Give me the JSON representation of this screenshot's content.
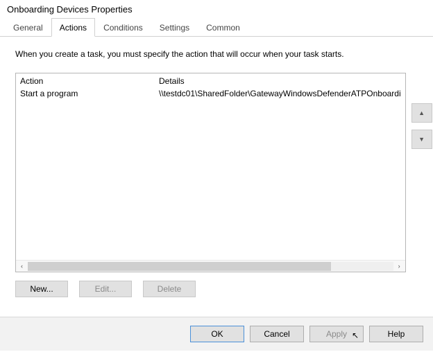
{
  "window": {
    "title": "Onboarding Devices Properties"
  },
  "tabs": [
    {
      "label": "General",
      "active": false
    },
    {
      "label": "Actions",
      "active": true
    },
    {
      "label": "Conditions",
      "active": false
    },
    {
      "label": "Settings",
      "active": false
    },
    {
      "label": "Common",
      "active": false
    }
  ],
  "instruction": "When you create a task, you must specify the action that will occur when your task starts.",
  "columns": {
    "action": "Action",
    "details": "Details"
  },
  "rows": [
    {
      "action": "Start a program",
      "details": "\\\\testdc01\\SharedFolder\\GatewayWindowsDefenderATPOnboardi"
    }
  ],
  "sideButtons": {
    "up": "▲",
    "down": "▼"
  },
  "scroll": {
    "left": "‹",
    "right": "›"
  },
  "rowButtons": {
    "new": "New...",
    "edit": "Edit...",
    "delete": "Delete"
  },
  "footerButtons": {
    "ok": "OK",
    "cancel": "Cancel",
    "apply": "Apply",
    "help": "Help"
  }
}
